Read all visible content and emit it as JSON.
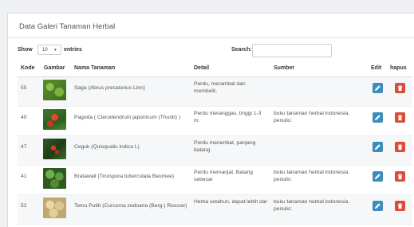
{
  "panel": {
    "title": "Data Galeri Tanaman Herbal"
  },
  "controls": {
    "show_label": "Show",
    "length_value": "10",
    "entries_label": "entries",
    "search_label": "Search:",
    "search_value": ""
  },
  "table": {
    "headers": {
      "kode": "Kode",
      "gambar": "Gambar",
      "nama": "Nama Tanaman",
      "detail": "Detail",
      "sumber": "Sumber",
      "edit": "Edit",
      "hapus": "hapus"
    },
    "rows": [
      {
        "kode": "55",
        "image": "saga-plant-photo",
        "nama": "Saga (Abrus precatorius Linn)",
        "detail": "Perdu, merambat dan membelit,",
        "sumber": ""
      },
      {
        "kode": "40",
        "image": "pagoda-plant-photo",
        "nama": "Pagoda ( Clerodendrum japonicum (Thunb) )",
        "detail": "Perdu meranggas, tinggi 1-3 m.",
        "sumber": "buku tanaman herbal indonesia. penulis:"
      },
      {
        "kode": "47",
        "image": "ceguk-plant-photo",
        "nama": "Ceguk (Quisqualis indica L)",
        "detail": "Perdu merambat, panjang batang",
        "sumber": ""
      },
      {
        "kode": "41",
        "image": "bratawali-plant-photo",
        "nama": "Bratawali (Tinospora tuberculata Beumee)",
        "detail": "Perdu memanjat. Batang sebesar",
        "sumber": "buku tanaman herbal indonesia. penulis:"
      },
      {
        "kode": "52",
        "image": "temu-putih-plant-photo",
        "nama": "Temu Putih (Curcuma zedoaria (Berg.) Roscoe)",
        "detail": "Herba setahun, dapat lebih dar",
        "sumber": "buku tanaman herbal indonesia. penulis:"
      }
    ]
  },
  "colors": {
    "edit_button": "#3c8dbc",
    "delete_button": "#dd4b39"
  },
  "icons": {
    "edit": "pencil-icon",
    "delete": "trash-icon",
    "select_caret": "caret-down-icon"
  }
}
